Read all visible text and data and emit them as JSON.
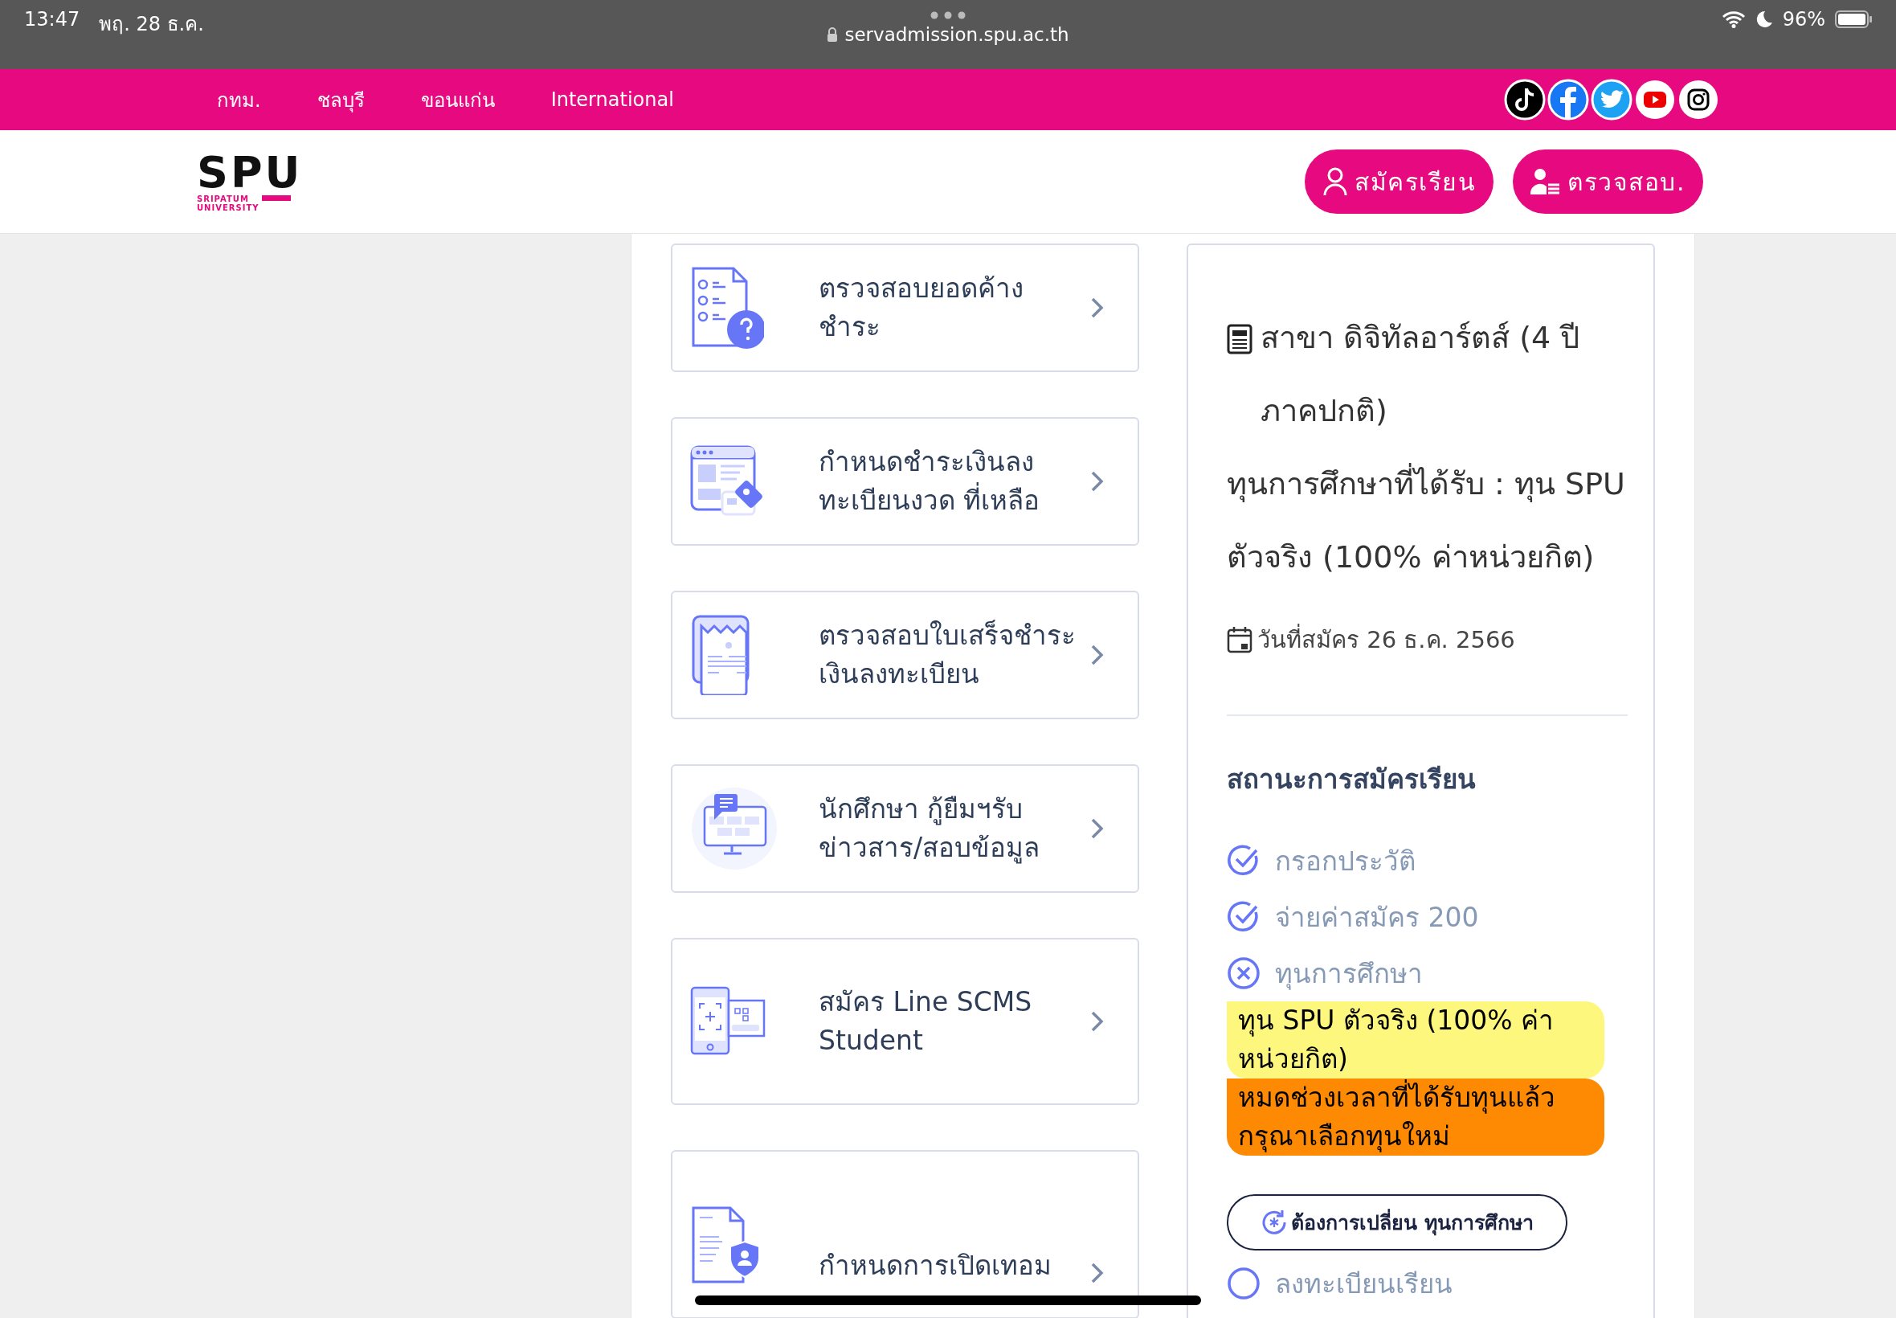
{
  "status_bar": {
    "time": "13:47",
    "date": "พฤ. 28 ธ.ค.",
    "url": "servadmission.spu.ac.th",
    "battery": "96%"
  },
  "nav": {
    "links": [
      "กทม.",
      "ชลบุรี",
      "ขอนแก่น",
      "International"
    ]
  },
  "header": {
    "logo": "SPU",
    "logo_lines": [
      "SRIPATUM",
      "UNIVERSITY"
    ],
    "buttons": [
      {
        "label": "สมัครเรียน",
        "kind": "apply"
      },
      {
        "label": "ตรวจสอบ.",
        "kind": "check"
      }
    ]
  },
  "menu": [
    {
      "label": "ตรวจสอบยอดค้าง ชำระ",
      "kind": "question-doc"
    },
    {
      "label": "กำหนดชำระเงินลง ทะเบียนงวด ที่เหลือ",
      "kind": "payment"
    },
    {
      "label": "ตรวจสอบใบเสร็จชำระ เงินลงทะเบียน",
      "kind": "receipt"
    },
    {
      "label": "นักศึกษา กู้ยืมฯรับ ข่าวสาร/สอบข้อมูล",
      "kind": "monitor"
    },
    {
      "label": "สมัคร Line SCMS Student",
      "kind": "phone"
    },
    {
      "label": "กำหนดการเปิดเทอม",
      "kind": "shield-doc"
    }
  ],
  "panel": {
    "program": "สาขา ดิจิทัลอาร์ตส์ (4 ปี ภาคปกติ)",
    "scholarship": "ทุนการศึกษาที่ได้รับ : ทุน SPU ตัวจริง (100% ค่าหน่วยกิต)",
    "applied_date": "วันที่สมัคร 26 ธ.ค. 2566",
    "status_title": "สถานะการสมัครเรียน",
    "steps": [
      {
        "label": "กรอกประวัติ",
        "kind": "done"
      },
      {
        "label": "จ่ายค่าสมัคร 200",
        "kind": "done"
      },
      {
        "label": "ทุนการศึกษา",
        "kind": "failed",
        "notes": [
          {
            "text": "ทุน SPU ตัวจริง (100% ค่าหน่วยกิต)",
            "color": "#fef77e"
          },
          {
            "text": "หมดช่วงเวลาที่ได้รับทุนแล้ว กรุณาเลือกทุนใหม่",
            "color": "#fd8a02"
          }
        ],
        "action": "ต้องการเปลี่ยน ทุนการศึกษา"
      },
      {
        "label": "ลงทะเบียนเรียน",
        "kind": "pending"
      }
    ]
  }
}
